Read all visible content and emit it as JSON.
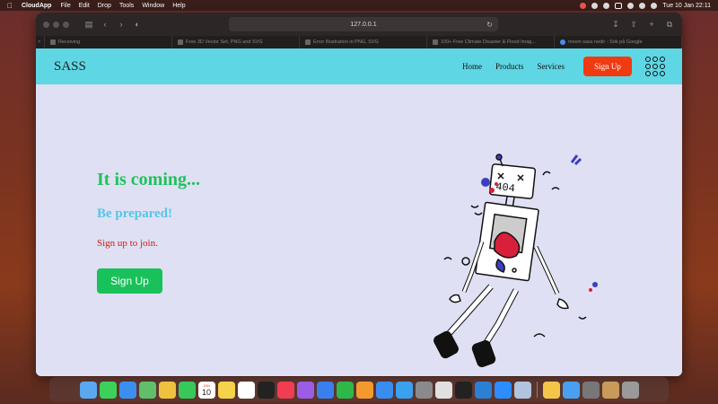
{
  "menubar": {
    "app_name": "CloudApp",
    "items": [
      "File",
      "Edit",
      "Drop",
      "Tools",
      "Window",
      "Help"
    ],
    "datetime": "Tue 10 Jan  22:11"
  },
  "browser": {
    "url": "127.0.0.1",
    "tabs": [
      {
        "title": "Receiving"
      },
      {
        "title": "Free 3D Vector Set, PNG and SVG"
      },
      {
        "title": "Error Illustration in PNG, SVG"
      },
      {
        "title": "100+ Free Climate Disaster & Flood Imag..."
      },
      {
        "title": "movin sass nedir - Sök på Google"
      }
    ]
  },
  "site": {
    "brand": "SASS",
    "nav": [
      "Home",
      "Products",
      "Services"
    ],
    "nav_button": "Sign Up",
    "hero": {
      "title": "It is coming...",
      "subtitle": "Be prepared!",
      "text": "Sign up to join.",
      "button": "Sign Up"
    },
    "illustration_text": "404",
    "colors": {
      "nav_bg": "#5fd6e3",
      "page_bg": "#dfe0f4",
      "title": "#1ec25b",
      "subtitle": "#55c6e6",
      "text": "#d01a10",
      "nav_button": "#f03a10",
      "hero_button": "#19c15a"
    }
  },
  "dock": {
    "calendar_day": "10",
    "calendar_month": "JAN",
    "icons": [
      "finder-icon",
      "messages-icon",
      "mail-icon",
      "maps-icon",
      "photos-icon",
      "facetime-icon",
      "calendar-icon",
      "notes-icon",
      "reminders-icon",
      "tv-icon",
      "music-icon",
      "podcasts-icon",
      "keynote-icon",
      "numbers-icon",
      "pages-icon",
      "appstore-icon",
      "safari-icon",
      "settings-icon",
      "textedit-icon",
      "terminal-icon",
      "vscode-icon",
      "zoom-icon",
      "preview-icon",
      "folder-icon",
      "downloads-icon",
      "screenshot-icon",
      "archive-icon",
      "trash-icon"
    ]
  }
}
